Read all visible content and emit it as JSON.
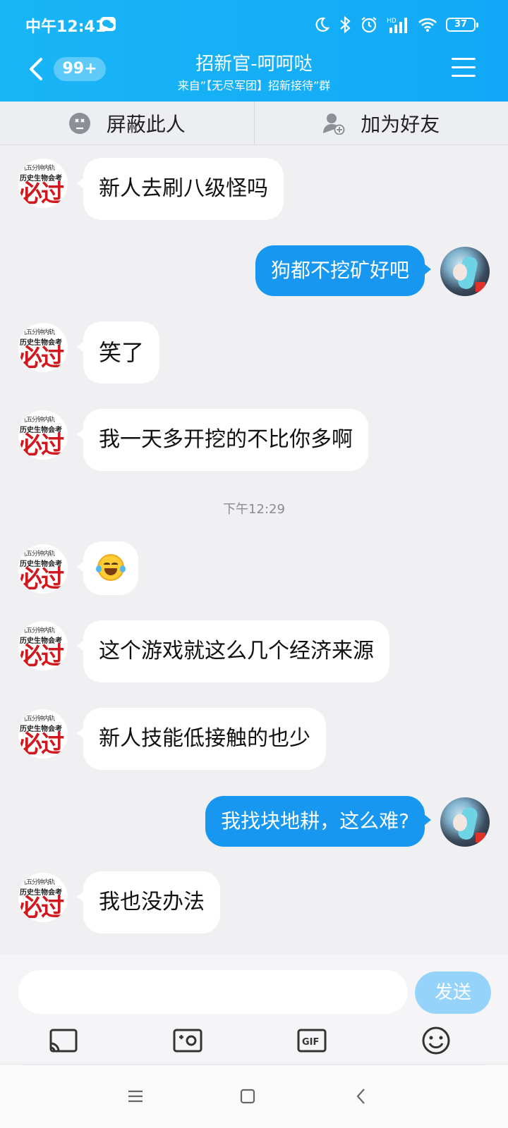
{
  "status": {
    "time": "中午12:41",
    "battery": "37"
  },
  "header": {
    "back_count": "99+",
    "title": "招新官-呵呵哒",
    "subtitle": "来自”【无尽军团】招新接待”群"
  },
  "actions": {
    "block": "屏蔽此人",
    "add_friend": "加为好友"
  },
  "avatar_left": {
    "line1": "几五分钟内轨",
    "line2": "历史生物会考",
    "line3": "必过"
  },
  "messages": [
    {
      "dir": "in",
      "text": "新人去刷八级怪吗"
    },
    {
      "dir": "out",
      "text": "狗都不挖矿好吧"
    },
    {
      "dir": "in",
      "text": "笑了"
    },
    {
      "dir": "in",
      "text": "我一天多开挖的不比你多啊"
    },
    {
      "dir": "time",
      "text": "下午12:29"
    },
    {
      "dir": "in",
      "emoji": "laughing-tears"
    },
    {
      "dir": "in",
      "text": "这个游戏就这么几个经济来源"
    },
    {
      "dir": "in",
      "text": "新人技能低接触的也少"
    },
    {
      "dir": "out",
      "text": "我找块地耕，这么难?"
    },
    {
      "dir": "in",
      "text": "我也没办法"
    }
  ],
  "composer": {
    "placeholder": "",
    "send_label": "发送"
  },
  "colors": {
    "header": "#12a8f7",
    "bubble_out": "#1797ef",
    "send_disabled": "#95d3fb"
  }
}
